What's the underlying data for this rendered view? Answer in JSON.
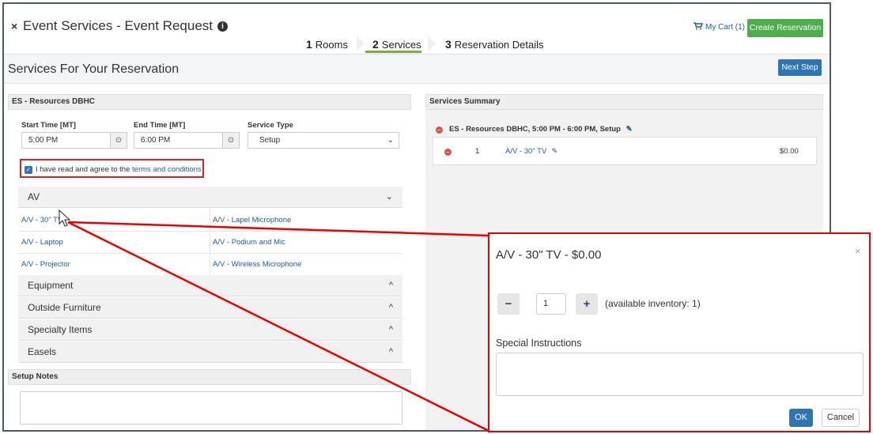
{
  "header": {
    "close_glyph": "×",
    "title": "Event Services - Event Request",
    "info_glyph": "i",
    "steps": [
      {
        "num": "1",
        "label": "Rooms"
      },
      {
        "num": "2",
        "label": "Services"
      },
      {
        "num": "3",
        "label": "Reservation Details"
      }
    ],
    "active_step": 2,
    "cart_label": "My Cart (1)",
    "create_button": "Create Reservation"
  },
  "subheader": {
    "title": "Services For Your Reservation",
    "next_button": "Next Step"
  },
  "resource_panel": {
    "title": "ES - Resources DBHC",
    "start_label": "Start Time [MT]",
    "start_value": "5:00 PM",
    "end_label": "End Time [MT]",
    "end_value": "6:00 PM",
    "service_type_label": "Service Type",
    "service_type_value": "Setup",
    "agree_prefix": "I have read and agree to the ",
    "agree_link": "terms and conditions",
    "agree_checked": true
  },
  "categories": {
    "av": {
      "label": "AV",
      "expanded": true,
      "items": [
        "A/V - 30\" TV",
        "A/V - Lapel Microphone",
        "A/V - Laptop",
        "A/V - Podium and Mic",
        "A/V - Projector",
        "A/V - Wireless Microphone"
      ]
    },
    "collapsed": [
      "Equipment",
      "Outside Furniture",
      "Specialty Items",
      "Easels"
    ]
  },
  "setup_notes": {
    "label": "Setup Notes"
  },
  "summary": {
    "title": "Services Summary",
    "group_label": "ES - Resources DBHC, 5:00 PM - 6:00 PM, Setup",
    "item_qty": "1",
    "item_name": "A/V - 30\" TV",
    "item_price": "$0.00"
  },
  "modal": {
    "title": "A/V - 30\" TV - $0.00",
    "close_glyph": "×",
    "minus": "−",
    "quantity": "1",
    "plus": "+",
    "availability": "(available inventory: 1)",
    "instructions_label": "Special Instructions",
    "ok_button": "OK",
    "cancel_button": "Cancel"
  },
  "colors": {
    "accent_green": "#76b043",
    "button_green": "#4cae4c",
    "primary_blue": "#2f74b5",
    "link_blue": "#1f5a9e",
    "highlight_red": "#e00000"
  }
}
